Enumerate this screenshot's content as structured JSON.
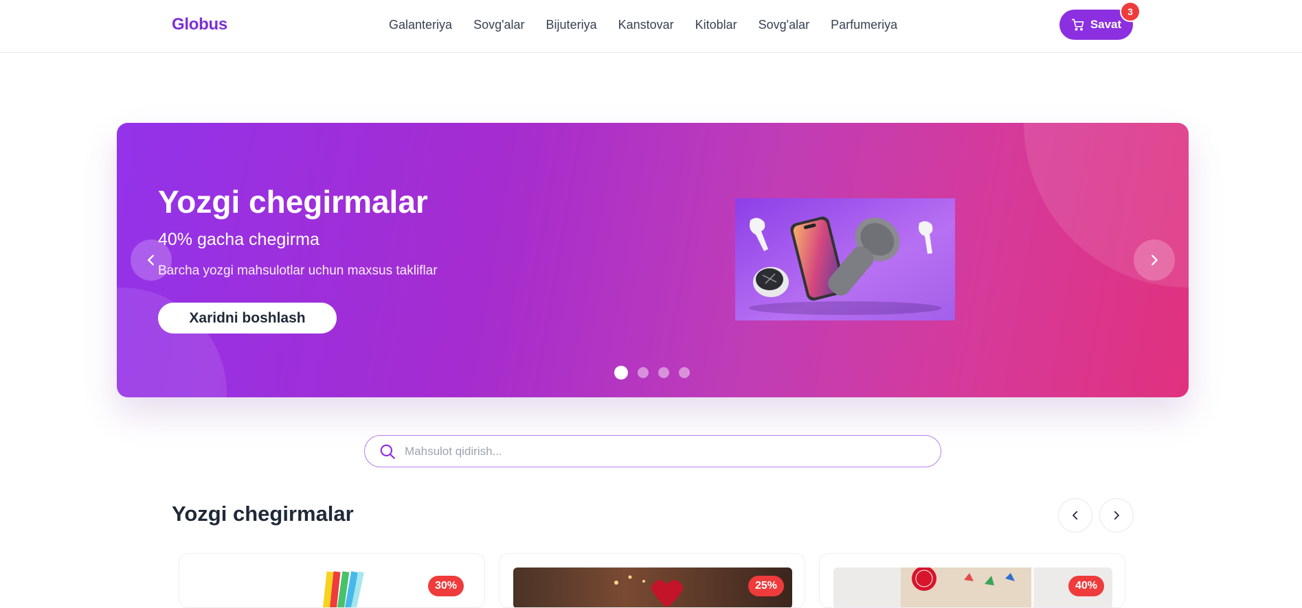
{
  "header": {
    "logo": "Globus",
    "nav": [
      "Galanteriya",
      "Sovg'alar",
      "Bijuteriya",
      "Kanstovar",
      "Kitoblar",
      "Sovg'alar",
      "Parfumeriya"
    ],
    "cart_label": "Savat",
    "cart_count": "3",
    "cart_icon": "cart-icon"
  },
  "banner": {
    "title": "Yozgi chegirmalar",
    "subtitle": "40% gacha chegirma",
    "description": "Barcha yozgi mahsulotlar uchun maxsus takliflar",
    "cta": "Xaridni boshlash",
    "slides_total": 4,
    "active_slide": 1,
    "colors": {
      "start": "#9333ea",
      "end": "#e0317e"
    }
  },
  "search": {
    "placeholder": "Mahsulot qidirish...",
    "value": "",
    "icon": "search-icon"
  },
  "section": {
    "title": "Yozgi chegirmalar"
  },
  "products": [
    {
      "discount": "30%"
    },
    {
      "discount": "25%"
    },
    {
      "discount": "40%"
    }
  ],
  "colors": {
    "accent": "#8b2fe0",
    "badge": "#ef3b3b"
  }
}
